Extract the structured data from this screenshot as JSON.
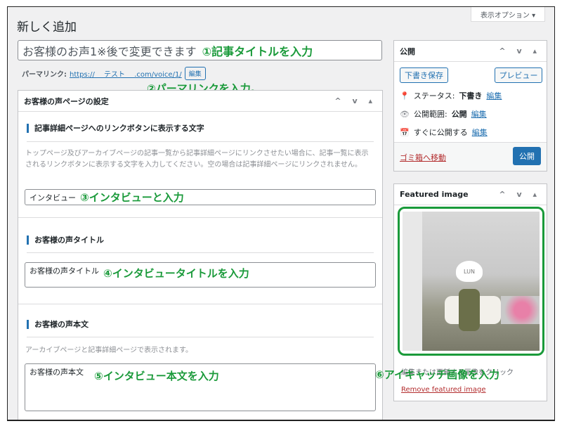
{
  "header": {
    "title": "新しく追加",
    "screen_options": "表示オプション ▾"
  },
  "post_title": {
    "value": "お客様のお声1※後で変更できます",
    "annotation": "①記事タイトルを入力"
  },
  "permalink": {
    "label": "パーマリンク:",
    "url": "https://　 テスト　 .com/voice/1/",
    "edit": "編集",
    "annotation": "②パーマリンクを入力。"
  },
  "settings_box": {
    "title": "お客様の声ページの設定",
    "controls": "^ v ▴",
    "link_text": {
      "heading": "記事詳細ページへのリンクボタンに表示する文字",
      "description": "トップページ及びアーカイブページの記事一覧から記事詳細ページにリンクさせたい場合に、記事一覧に表示されるリンクボタンに表示する文字を入力してください。空の場合は記事詳細ページにリンクされません。",
      "value": "インタビュー",
      "annotation": "③インタビューと入力"
    },
    "voice_title": {
      "heading": "お客様の声タイトル",
      "value": "お客様の声タイトル",
      "annotation": "④インタビュータイトルを入力"
    },
    "voice_body": {
      "heading": "お客様の声本文",
      "description": "アーカイブページと記事詳細ページで表示されます。",
      "value": "お客様の声本文",
      "annotation": "⑤インタビュー本文を入力"
    }
  },
  "publish_box": {
    "title": "公開",
    "save_draft": "下書き保存",
    "preview": "プレビュー",
    "status_label": "ステータス:",
    "status_value": "下書き",
    "visibility_label": "公開範囲:",
    "visibility_value": "公開",
    "schedule": "すぐに公開する",
    "edit": "編集",
    "trash": "ゴミ箱へ移動",
    "publish": "公開"
  },
  "featured_image": {
    "title": "Featured image",
    "image_label": "LUN",
    "hint": "編集または更新する画像をクリック",
    "remove": "Remove featured image",
    "annotation": "⑥アイキャッチ画像を入力"
  },
  "colors": {
    "accent": "#2271b1",
    "annotation": "#1a9a3a",
    "trash": "#b32d2e"
  }
}
